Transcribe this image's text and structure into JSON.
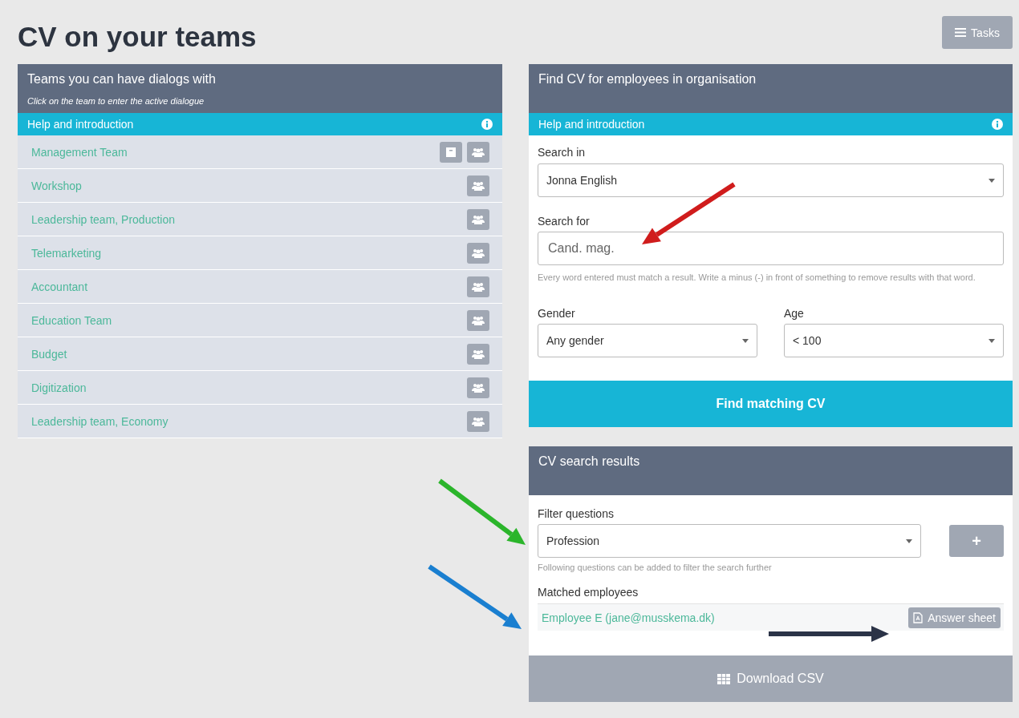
{
  "page": {
    "title": "CV on your teams",
    "tasks_button": "Tasks"
  },
  "teams_panel": {
    "title": "Teams you can have dialogs with",
    "subtitle": "Click on the team to enter the active dialogue",
    "help_bar": "Help and introduction",
    "teams": [
      {
        "name": "Management Team",
        "archive_button": true
      },
      {
        "name": "Workshop",
        "archive_button": false
      },
      {
        "name": "Leadership team, Production",
        "archive_button": false
      },
      {
        "name": "Telemarketing",
        "archive_button": false
      },
      {
        "name": "Accountant",
        "archive_button": false
      },
      {
        "name": "Education Team",
        "archive_button": false
      },
      {
        "name": "Budget",
        "archive_button": false
      },
      {
        "name": "Digitization",
        "archive_button": false
      },
      {
        "name": "Leadership team, Economy",
        "archive_button": false
      }
    ]
  },
  "search_panel": {
    "title": "Find CV for employees in organisation",
    "help_bar": "Help and introduction",
    "search_in": {
      "label": "Search in",
      "value": "Jonna English"
    },
    "search_for": {
      "label": "Search for",
      "placeholder": "Cand. mag."
    },
    "hint": "Every word entered must match a result. Write a minus (-) in front of something to remove results with that word.",
    "gender": {
      "label": "Gender",
      "value": "Any gender"
    },
    "age": {
      "label": "Age",
      "value": "< 100"
    },
    "submit": "Find matching CV"
  },
  "results_panel": {
    "title": "CV search results",
    "filter": {
      "label": "Filter questions",
      "value": "Profession",
      "add_button": "+",
      "hint": "Following questions can be added to filter the search further"
    },
    "matched_label": "Matched employees",
    "employees": [
      {
        "name": "Employee E (jane@musskema.dk)",
        "action": "Answer sheet"
      }
    ],
    "download": "Download CSV"
  },
  "annotations": [
    {
      "color": "#d01c1c"
    },
    {
      "color": "#2bb52b"
    },
    {
      "color": "#1a7fd0"
    },
    {
      "color": "#2b3347"
    }
  ]
}
